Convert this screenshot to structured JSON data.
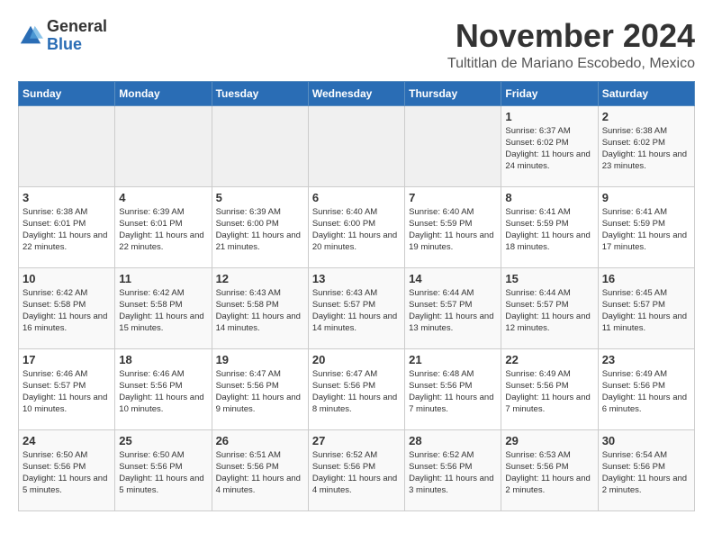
{
  "logo": {
    "general": "General",
    "blue": "Blue"
  },
  "header": {
    "month": "November 2024",
    "location": "Tultitlan de Mariano Escobedo, Mexico"
  },
  "weekdays": [
    "Sunday",
    "Monday",
    "Tuesday",
    "Wednesday",
    "Thursday",
    "Friday",
    "Saturday"
  ],
  "weeks": [
    [
      {
        "day": "",
        "info": ""
      },
      {
        "day": "",
        "info": ""
      },
      {
        "day": "",
        "info": ""
      },
      {
        "day": "",
        "info": ""
      },
      {
        "day": "",
        "info": ""
      },
      {
        "day": "1",
        "info": "Sunrise: 6:37 AM\nSunset: 6:02 PM\nDaylight: 11 hours and 24 minutes."
      },
      {
        "day": "2",
        "info": "Sunrise: 6:38 AM\nSunset: 6:02 PM\nDaylight: 11 hours and 23 minutes."
      }
    ],
    [
      {
        "day": "3",
        "info": "Sunrise: 6:38 AM\nSunset: 6:01 PM\nDaylight: 11 hours and 22 minutes."
      },
      {
        "day": "4",
        "info": "Sunrise: 6:39 AM\nSunset: 6:01 PM\nDaylight: 11 hours and 22 minutes."
      },
      {
        "day": "5",
        "info": "Sunrise: 6:39 AM\nSunset: 6:00 PM\nDaylight: 11 hours and 21 minutes."
      },
      {
        "day": "6",
        "info": "Sunrise: 6:40 AM\nSunset: 6:00 PM\nDaylight: 11 hours and 20 minutes."
      },
      {
        "day": "7",
        "info": "Sunrise: 6:40 AM\nSunset: 5:59 PM\nDaylight: 11 hours and 19 minutes."
      },
      {
        "day": "8",
        "info": "Sunrise: 6:41 AM\nSunset: 5:59 PM\nDaylight: 11 hours and 18 minutes."
      },
      {
        "day": "9",
        "info": "Sunrise: 6:41 AM\nSunset: 5:59 PM\nDaylight: 11 hours and 17 minutes."
      }
    ],
    [
      {
        "day": "10",
        "info": "Sunrise: 6:42 AM\nSunset: 5:58 PM\nDaylight: 11 hours and 16 minutes."
      },
      {
        "day": "11",
        "info": "Sunrise: 6:42 AM\nSunset: 5:58 PM\nDaylight: 11 hours and 15 minutes."
      },
      {
        "day": "12",
        "info": "Sunrise: 6:43 AM\nSunset: 5:58 PM\nDaylight: 11 hours and 14 minutes."
      },
      {
        "day": "13",
        "info": "Sunrise: 6:43 AM\nSunset: 5:57 PM\nDaylight: 11 hours and 14 minutes."
      },
      {
        "day": "14",
        "info": "Sunrise: 6:44 AM\nSunset: 5:57 PM\nDaylight: 11 hours and 13 minutes."
      },
      {
        "day": "15",
        "info": "Sunrise: 6:44 AM\nSunset: 5:57 PM\nDaylight: 11 hours and 12 minutes."
      },
      {
        "day": "16",
        "info": "Sunrise: 6:45 AM\nSunset: 5:57 PM\nDaylight: 11 hours and 11 minutes."
      }
    ],
    [
      {
        "day": "17",
        "info": "Sunrise: 6:46 AM\nSunset: 5:57 PM\nDaylight: 11 hours and 10 minutes."
      },
      {
        "day": "18",
        "info": "Sunrise: 6:46 AM\nSunset: 5:56 PM\nDaylight: 11 hours and 10 minutes."
      },
      {
        "day": "19",
        "info": "Sunrise: 6:47 AM\nSunset: 5:56 PM\nDaylight: 11 hours and 9 minutes."
      },
      {
        "day": "20",
        "info": "Sunrise: 6:47 AM\nSunset: 5:56 PM\nDaylight: 11 hours and 8 minutes."
      },
      {
        "day": "21",
        "info": "Sunrise: 6:48 AM\nSunset: 5:56 PM\nDaylight: 11 hours and 7 minutes."
      },
      {
        "day": "22",
        "info": "Sunrise: 6:49 AM\nSunset: 5:56 PM\nDaylight: 11 hours and 7 minutes."
      },
      {
        "day": "23",
        "info": "Sunrise: 6:49 AM\nSunset: 5:56 PM\nDaylight: 11 hours and 6 minutes."
      }
    ],
    [
      {
        "day": "24",
        "info": "Sunrise: 6:50 AM\nSunset: 5:56 PM\nDaylight: 11 hours and 5 minutes."
      },
      {
        "day": "25",
        "info": "Sunrise: 6:50 AM\nSunset: 5:56 PM\nDaylight: 11 hours and 5 minutes."
      },
      {
        "day": "26",
        "info": "Sunrise: 6:51 AM\nSunset: 5:56 PM\nDaylight: 11 hours and 4 minutes."
      },
      {
        "day": "27",
        "info": "Sunrise: 6:52 AM\nSunset: 5:56 PM\nDaylight: 11 hours and 4 minutes."
      },
      {
        "day": "28",
        "info": "Sunrise: 6:52 AM\nSunset: 5:56 PM\nDaylight: 11 hours and 3 minutes."
      },
      {
        "day": "29",
        "info": "Sunrise: 6:53 AM\nSunset: 5:56 PM\nDaylight: 11 hours and 2 minutes."
      },
      {
        "day": "30",
        "info": "Sunrise: 6:54 AM\nSunset: 5:56 PM\nDaylight: 11 hours and 2 minutes."
      }
    ]
  ]
}
